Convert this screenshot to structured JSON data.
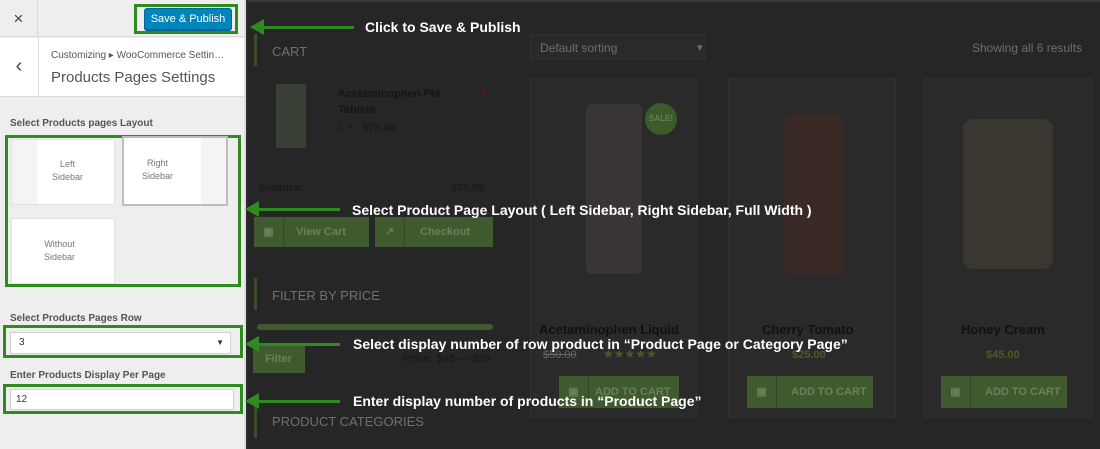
{
  "customizer": {
    "close_icon": "×",
    "publish_label": "Save & Publish",
    "back_icon": "‹",
    "breadcrumb": "Customizing ▸ WooCommerce Settin…",
    "section_title": "Products Pages Settings",
    "layout_label": "Select Products pages Layout",
    "layout_options": [
      {
        "line1": "Left",
        "line2": "Sidebar"
      },
      {
        "line1": "Right",
        "line2": "Sidebar"
      },
      {
        "line1": "Without",
        "line2": "Sidebar"
      }
    ],
    "row_label": "Select Products Pages Row",
    "row_value": "3",
    "row_arrow": "▼",
    "perpage_label": "Enter Products Display Per Page",
    "perpage_value": "12"
  },
  "preview": {
    "cart_title": "CART",
    "cart_item_name_1": "Acetaminophen PM",
    "cart_item_name_2": "Tablets",
    "cart_item_qty": "1 ×",
    "cart_item_price": "$75.00",
    "remove_icon": "×",
    "subtotal_label": "Subtotal:",
    "subtotal_value": "$75.00",
    "view_cart": "View Cart",
    "checkout": "Checkout",
    "filter_title": "FILTER BY PRICE",
    "filter_button": "Filter",
    "price_range": "Price: $45 — $99",
    "categories_title": "PRODUCT CATEGORIES",
    "sorting": "Default sorting",
    "sorting_arrow": "▾",
    "results": "Showing all 6 results",
    "sale_badge": "SALE!",
    "add_to_cart": "ADD TO CART",
    "products": [
      {
        "name": "Acetaminophen Liquid",
        "old_price": "$50.00",
        "stars": "★★★★★"
      },
      {
        "name": "Cherry Tomato",
        "price": "$25.00"
      },
      {
        "name": "Honey Cream",
        "price": "$45.00"
      }
    ]
  },
  "annotations": {
    "publish": "Click to Save & Publish",
    "layout": "Select Product Page Layout ( Left Sidebar, Right Sidebar, Full Width )",
    "row": "Select display number of row product in “Product Page or Category Page”",
    "perpage": "Enter display number of products in “Product Page”"
  },
  "colors": {
    "annotation_green": "#2f8a1f",
    "publish_blue": "#0085ba"
  }
}
